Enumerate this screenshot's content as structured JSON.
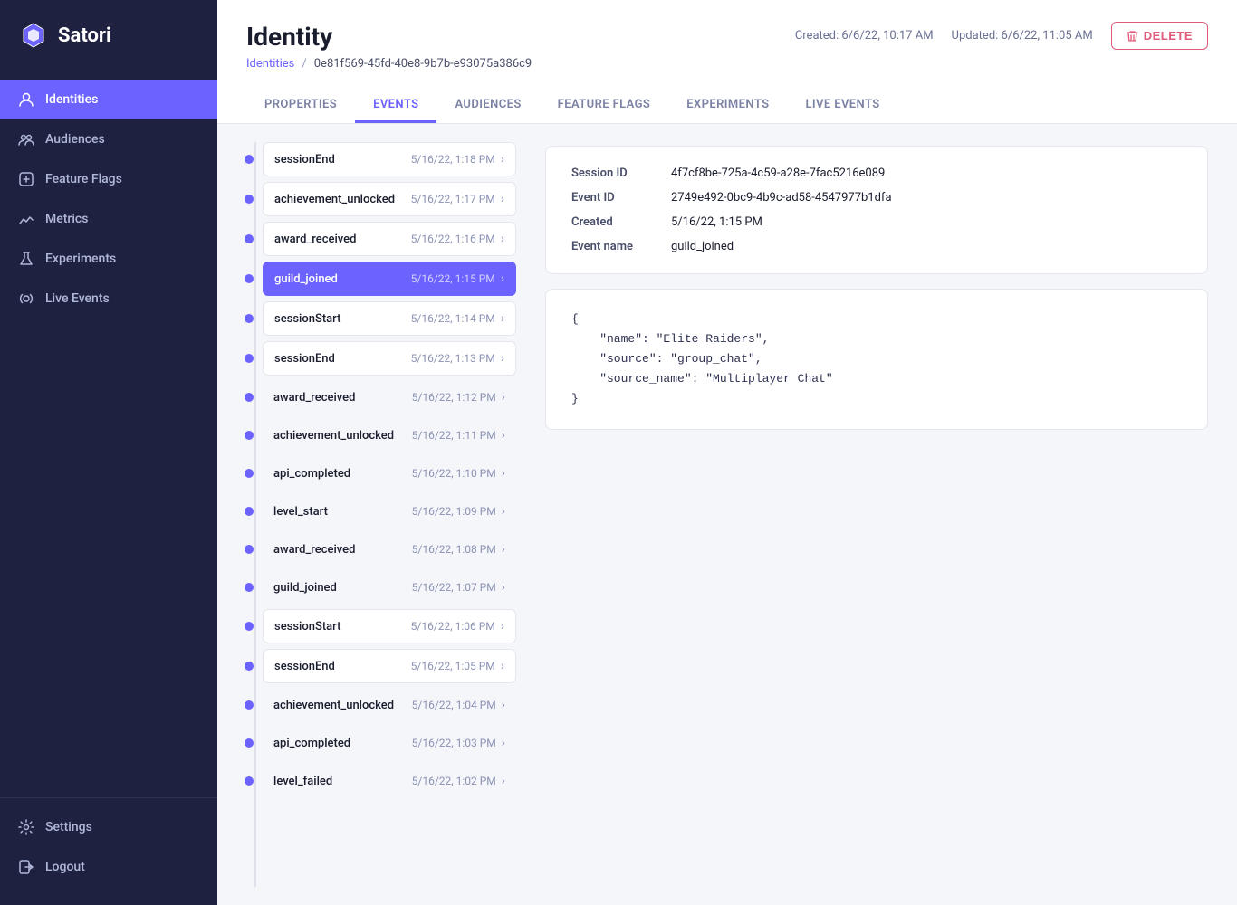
{
  "app": {
    "name": "Satori"
  },
  "sidebar": {
    "items": [
      {
        "id": "identities",
        "label": "Identities",
        "active": true
      },
      {
        "id": "audiences",
        "label": "Audiences",
        "active": false
      },
      {
        "id": "feature-flags",
        "label": "Feature Flags",
        "active": false
      },
      {
        "id": "metrics",
        "label": "Metrics",
        "active": false
      },
      {
        "id": "experiments",
        "label": "Experiments",
        "active": false
      },
      {
        "id": "live-events",
        "label": "Live Events",
        "active": false
      }
    ],
    "bottom": [
      {
        "id": "settings",
        "label": "Settings"
      },
      {
        "id": "logout",
        "label": "Logout"
      }
    ]
  },
  "header": {
    "title": "Identity",
    "breadcrumb_link": "Identities",
    "breadcrumb_id": "0e81f569-45fd-40e8-9b7b-e93075a386c9",
    "created": "Created: 6/6/22, 10:17 AM",
    "updated": "Updated: 6/6/22, 11:05 AM",
    "delete_label": "DELETE"
  },
  "tabs": [
    {
      "id": "properties",
      "label": "PROPERTIES",
      "active": false
    },
    {
      "id": "events",
      "label": "EVENTS",
      "active": true
    },
    {
      "id": "audiences",
      "label": "AUDIENCES",
      "active": false
    },
    {
      "id": "feature-flags",
      "label": "FEATURE FLAGS",
      "active": false
    },
    {
      "id": "experiments",
      "label": "EXPERIMENTS",
      "active": false
    },
    {
      "id": "live-events",
      "label": "LIVE EVENTS",
      "active": false
    }
  ],
  "events": [
    {
      "name": "sessionEnd",
      "time": "5/16/22, 1:18 PM",
      "has_card": true,
      "active": false
    },
    {
      "name": "achievement_unlocked",
      "time": "5/16/22, 1:17 PM",
      "has_card": true,
      "active": false
    },
    {
      "name": "award_received",
      "time": "5/16/22, 1:16 PM",
      "has_card": true,
      "active": false
    },
    {
      "name": "guild_joined",
      "time": "5/16/22, 1:15 PM",
      "has_card": true,
      "active": true
    },
    {
      "name": "sessionStart",
      "time": "5/16/22, 1:14 PM",
      "has_card": true,
      "active": false
    },
    {
      "name": "sessionEnd",
      "time": "5/16/22, 1:13 PM",
      "has_card": true,
      "active": false
    },
    {
      "name": "award_received",
      "time": "5/16/22, 1:12 PM",
      "has_card": false,
      "active": false
    },
    {
      "name": "achievement_unlocked",
      "time": "5/16/22, 1:11 PM",
      "has_card": false,
      "active": false
    },
    {
      "name": "api_completed",
      "time": "5/16/22, 1:10 PM",
      "has_card": false,
      "active": false
    },
    {
      "name": "level_start",
      "time": "5/16/22, 1:09 PM",
      "has_card": false,
      "active": false
    },
    {
      "name": "award_received",
      "time": "5/16/22, 1:08 PM",
      "has_card": false,
      "active": false
    },
    {
      "name": "guild_joined",
      "time": "5/16/22, 1:07 PM",
      "has_card": false,
      "active": false
    },
    {
      "name": "sessionStart",
      "time": "5/16/22, 1:06 PM",
      "has_card": true,
      "active": false
    },
    {
      "name": "sessionEnd",
      "time": "5/16/22, 1:05 PM",
      "has_card": true,
      "active": false
    },
    {
      "name": "achievement_unlocked",
      "time": "5/16/22, 1:04 PM",
      "has_card": false,
      "active": false
    },
    {
      "name": "api_completed",
      "time": "5/16/22, 1:03 PM",
      "has_card": false,
      "active": false
    },
    {
      "name": "level_failed",
      "time": "5/16/22, 1:02 PM",
      "has_card": false,
      "active": false
    }
  ],
  "detail": {
    "session_id_label": "Session ID",
    "session_id_value": "4f7cf8be-725a-4c59-a28e-7fac5216e089",
    "event_id_label": "Event ID",
    "event_id_value": "2749e492-0bc9-4b9c-ad58-4547977b1dfa",
    "created_label": "Created",
    "created_value": "5/16/22, 1:15 PM",
    "event_name_label": "Event name",
    "event_name_value": "guild_joined",
    "json_content": "{\n    \"name\": \"Elite Raiders\",\n    \"source\": \"group_chat\",\n    \"source_name\": \"Multiplayer Chat\"\n}"
  }
}
